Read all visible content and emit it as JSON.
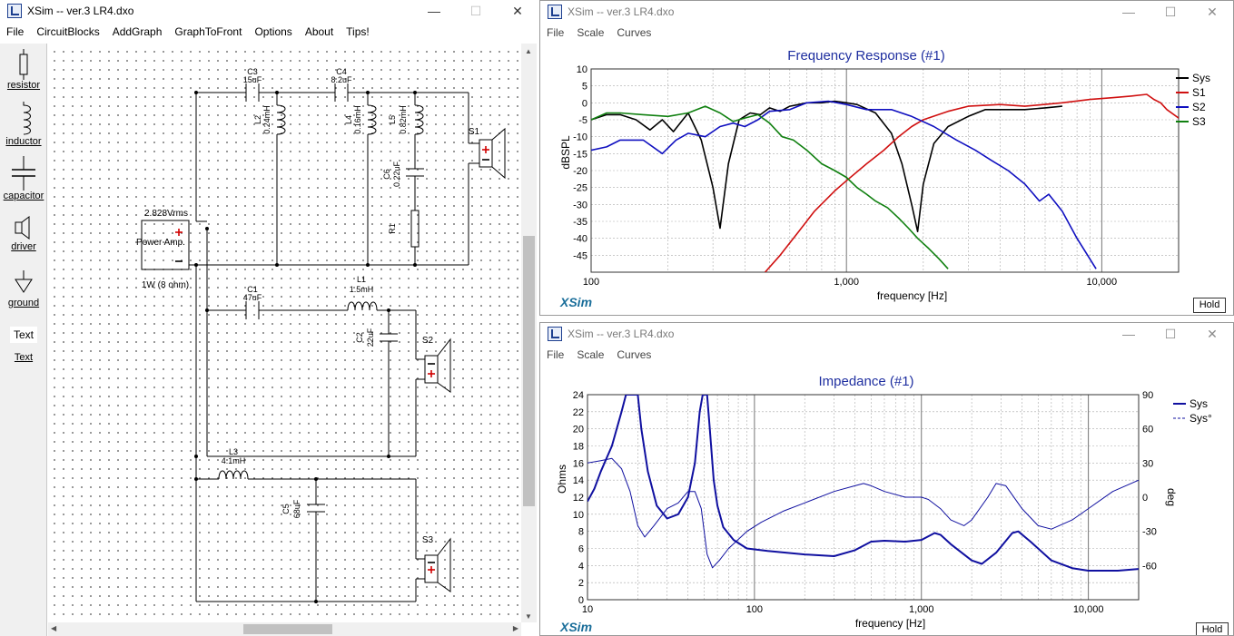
{
  "main_window": {
    "title": "XSim -- ver.3 LR4.dxo",
    "menu": [
      "File",
      "CircuitBlocks",
      "AddGraph",
      "GraphToFront",
      "Options",
      "About",
      "Tips!"
    ],
    "palette": [
      {
        "label": "resistor",
        "icon": "resistor-icon"
      },
      {
        "label": "inductor",
        "icon": "inductor-icon"
      },
      {
        "label": "capacitor",
        "icon": "capacitor-icon"
      },
      {
        "label": "driver",
        "icon": "driver-icon"
      },
      {
        "label": "ground",
        "icon": "ground-icon"
      },
      {
        "label": "Text",
        "icon": "text-icon",
        "preview": "Text"
      }
    ],
    "schematic": {
      "source_voltage": "2.828Vrms",
      "source_name": "Power Amp.",
      "source_note": "1W (8 ohm)",
      "components": {
        "C3_name": "C3",
        "C3_value": "15uF",
        "C4_name": "C4",
        "C4_value": "8.2uF",
        "L2_name": "L2",
        "L2_value": "0.24mH",
        "L4_name": "L4",
        "L4_value": "0.16mH",
        "L5_name": "L5",
        "L5_value": "0.82mH",
        "C6_name": "C6",
        "C6_value": "0.22uF",
        "R1_name": "R1",
        "C1_name": "C1",
        "C1_value": "47uF",
        "L1_name": "L1",
        "L1_value": "1.5mH",
        "C2_name": "C2",
        "C2_value": "22uF",
        "L3_name": "L3",
        "L3_value": "4.1mH",
        "C5_name": "C5",
        "C5_value": "68uF"
      },
      "drivers": [
        "S1",
        "S2",
        "S3"
      ]
    }
  },
  "freq_window": {
    "title": "XSim -- ver.3 LR4.dxo",
    "menu": [
      "File",
      "Scale",
      "Curves"
    ],
    "plot_title": "Frequency Response (#1)",
    "brand": "XSim",
    "hold_label": "Hold",
    "colors": {
      "Sys": "#000000",
      "S1": "#d01010",
      "S2": "#1010c0",
      "S3": "#108010",
      "title": "#1f2fa0"
    }
  },
  "imp_window": {
    "title": "XSim -- ver.3 LR4.dxo",
    "menu": [
      "File",
      "Scale",
      "Curves"
    ],
    "plot_title": "Impedance (#1)",
    "brand": "XSim",
    "hold_label": "Hold",
    "colors": {
      "Sys": "#1010a0",
      "title": "#1f2fa0"
    }
  },
  "chart_data": [
    {
      "type": "line",
      "title": "Frequency Response (#1)",
      "xlabel": "frequency [Hz]",
      "ylabel": "dBSPL",
      "xscale": "log",
      "xlim": [
        100,
        20000
      ],
      "ylim": [
        -50,
        10
      ],
      "xticks": [
        100,
        1000,
        10000
      ],
      "xtick_labels": [
        "100",
        "1,000",
        "10,000"
      ],
      "yticks": [
        10,
        5,
        0,
        -5,
        -10,
        -15,
        -20,
        -25,
        -30,
        -35,
        -40,
        -45
      ],
      "grid": true,
      "legend": "right",
      "series": [
        {
          "name": "Sys",
          "color": "#000000",
          "points": [
            [
              100,
              -5
            ],
            [
              115,
              -3.5
            ],
            [
              130,
              -3.5
            ],
            [
              150,
              -5
            ],
            [
              170,
              -8
            ],
            [
              190,
              -5
            ],
            [
              210,
              -8.5
            ],
            [
              240,
              -3
            ],
            [
              270,
              -11
            ],
            [
              300,
              -25
            ],
            [
              320,
              -37
            ],
            [
              345,
              -18
            ],
            [
              380,
              -5
            ],
            [
              420,
              -3
            ],
            [
              460,
              -3.5
            ],
            [
              500,
              -1.5
            ],
            [
              550,
              -2.5
            ],
            [
              600,
              -1
            ],
            [
              650,
              -0.5
            ],
            [
              700,
              0
            ],
            [
              800,
              0
            ],
            [
              900,
              0.5
            ],
            [
              1000,
              0
            ],
            [
              1100,
              -0.5
            ],
            [
              1300,
              -3
            ],
            [
              1500,
              -9
            ],
            [
              1650,
              -18
            ],
            [
              1800,
              -30
            ],
            [
              1900,
              -38
            ],
            [
              2000,
              -24
            ],
            [
              2200,
              -12
            ],
            [
              2500,
              -7
            ],
            [
              3000,
              -4
            ],
            [
              3500,
              -2
            ],
            [
              4000,
              -2
            ],
            [
              5000,
              -2
            ],
            [
              6000,
              -1.5
            ],
            [
              7000,
              -1
            ]
          ]
        },
        {
          "name": "S1",
          "color": "#d01010",
          "points": [
            [
              480,
              -50
            ],
            [
              550,
              -45
            ],
            [
              650,
              -38
            ],
            [
              750,
              -32
            ],
            [
              900,
              -26
            ],
            [
              1000,
              -23
            ],
            [
              1200,
              -18
            ],
            [
              1400,
              -14
            ],
            [
              1600,
              -10
            ],
            [
              1800,
              -7
            ],
            [
              2000,
              -5
            ],
            [
              2500,
              -2.5
            ],
            [
              3000,
              -1
            ],
            [
              4000,
              -0.5
            ],
            [
              5000,
              -1
            ],
            [
              7000,
              0
            ],
            [
              9000,
              1
            ],
            [
              11000,
              1.5
            ],
            [
              13000,
              2
            ],
            [
              15000,
              2.5
            ],
            [
              16000,
              1
            ],
            [
              17000,
              0
            ],
            [
              18000,
              -2
            ],
            [
              20000,
              -4.5
            ]
          ]
        },
        {
          "name": "S2",
          "color": "#1010c0",
          "points": [
            [
              100,
              -14
            ],
            [
              115,
              -13
            ],
            [
              130,
              -11
            ],
            [
              160,
              -11
            ],
            [
              190,
              -15
            ],
            [
              215,
              -11
            ],
            [
              240,
              -9
            ],
            [
              280,
              -10
            ],
            [
              320,
              -7
            ],
            [
              360,
              -6
            ],
            [
              400,
              -7
            ],
            [
              450,
              -5
            ],
            [
              500,
              -2.5
            ],
            [
              600,
              -2
            ],
            [
              700,
              0
            ],
            [
              850,
              0.5
            ],
            [
              1000,
              -0.5
            ],
            [
              1200,
              -2
            ],
            [
              1500,
              -2
            ],
            [
              1800,
              -4
            ],
            [
              2200,
              -7
            ],
            [
              2700,
              -11
            ],
            [
              3200,
              -14
            ],
            [
              3700,
              -17
            ],
            [
              4300,
              -20
            ],
            [
              5000,
              -24
            ],
            [
              5700,
              -29
            ],
            [
              6200,
              -27
            ],
            [
              7000,
              -32
            ],
            [
              8000,
              -40
            ],
            [
              9500,
              -49
            ]
          ]
        },
        {
          "name": "S3",
          "color": "#108010",
          "points": [
            [
              100,
              -5
            ],
            [
              115,
              -3
            ],
            [
              130,
              -3
            ],
            [
              160,
              -3.5
            ],
            [
              200,
              -4
            ],
            [
              240,
              -3
            ],
            [
              280,
              -1
            ],
            [
              320,
              -3
            ],
            [
              360,
              -5.5
            ],
            [
              400,
              -4.5
            ],
            [
              450,
              -3.5
            ],
            [
              500,
              -6
            ],
            [
              560,
              -10
            ],
            [
              620,
              -11
            ],
            [
              700,
              -14
            ],
            [
              800,
              -18
            ],
            [
              900,
              -20
            ],
            [
              1000,
              -22
            ],
            [
              1100,
              -25
            ],
            [
              1200,
              -27
            ],
            [
              1300,
              -29
            ],
            [
              1450,
              -31
            ],
            [
              1600,
              -34
            ],
            [
              1750,
              -37
            ],
            [
              1900,
              -40
            ],
            [
              2100,
              -43
            ],
            [
              2300,
              -46
            ],
            [
              2500,
              -49
            ]
          ]
        }
      ]
    },
    {
      "type": "line",
      "title": "Impedance (#1)",
      "xlabel": "frequency [Hz]",
      "ylabel": "Ohms",
      "y2label": "deg",
      "xscale": "log",
      "xlim": [
        10,
        20000
      ],
      "ylim": [
        0,
        24
      ],
      "y2lim": [
        -90,
        90
      ],
      "xticks": [
        10,
        100,
        1000,
        10000
      ],
      "xtick_labels": [
        "10",
        "100",
        "1,000",
        "10,000"
      ],
      "yticks": [
        24,
        22,
        20,
        18,
        16,
        14,
        12,
        10,
        8,
        6,
        4,
        2,
        0
      ],
      "y2ticks": [
        90,
        60,
        30,
        0,
        -30,
        -60
      ],
      "grid": true,
      "legend": "right",
      "series": [
        {
          "name": "Sys",
          "color": "#1010a0",
          "axis": "left",
          "points": [
            [
              10,
              11.5
            ],
            [
              11,
              13
            ],
            [
              12,
              15
            ],
            [
              14,
              18
            ],
            [
              16,
              22
            ],
            [
              17,
              24
            ],
            [
              20,
              24
            ],
            [
              21,
              20
            ],
            [
              23,
              15
            ],
            [
              26,
              11
            ],
            [
              30,
              9.5
            ],
            [
              35,
              10
            ],
            [
              40,
              12
            ],
            [
              44,
              16
            ],
            [
              47,
              22
            ],
            [
              49,
              24
            ],
            [
              52,
              24
            ],
            [
              54,
              20
            ],
            [
              57,
              14
            ],
            [
              60,
              11
            ],
            [
              65,
              8.5
            ],
            [
              75,
              7
            ],
            [
              90,
              6
            ],
            [
              120,
              5.7
            ],
            [
              200,
              5.3
            ],
            [
              300,
              5.1
            ],
            [
              400,
              5.8
            ],
            [
              500,
              6.8
            ],
            [
              600,
              6.9
            ],
            [
              800,
              6.8
            ],
            [
              1000,
              7
            ],
            [
              1200,
              7.8
            ],
            [
              1300,
              7.6
            ],
            [
              1500,
              6.5
            ],
            [
              2000,
              4.6
            ],
            [
              2300,
              4.2
            ],
            [
              2800,
              5.5
            ],
            [
              3500,
              7.8
            ],
            [
              3800,
              8
            ],
            [
              4500,
              6.8
            ],
            [
              6000,
              4.6
            ],
            [
              8000,
              3.7
            ],
            [
              10000,
              3.4
            ],
            [
              15000,
              3.4
            ],
            [
              20000,
              3.6
            ]
          ]
        },
        {
          "name": "Sys°",
          "color": "#1010a0",
          "axis": "right",
          "dashed_below": 60,
          "points": [
            [
              10,
              30
            ],
            [
              12,
              32
            ],
            [
              14,
              34
            ],
            [
              16,
              25
            ],
            [
              18,
              5
            ],
            [
              20,
              -25
            ],
            [
              22,
              -35
            ],
            [
              25,
              -25
            ],
            [
              30,
              -10
            ],
            [
              35,
              -5
            ],
            [
              40,
              5
            ],
            [
              44,
              5
            ],
            [
              48,
              -10
            ],
            [
              52,
              -50
            ],
            [
              56,
              -62
            ],
            [
              62,
              -55
            ],
            [
              70,
              -45
            ],
            [
              90,
              -30
            ],
            [
              110,
              -22
            ],
            [
              150,
              -12
            ],
            [
              200,
              -5
            ],
            [
              300,
              5
            ],
            [
              400,
              10
            ],
            [
              450,
              12
            ],
            [
              500,
              10
            ],
            [
              600,
              5
            ],
            [
              800,
              0
            ],
            [
              1000,
              0
            ],
            [
              1100,
              -2
            ],
            [
              1300,
              -10
            ],
            [
              1500,
              -20
            ],
            [
              1800,
              -25
            ],
            [
              2000,
              -20
            ],
            [
              2500,
              0
            ],
            [
              2800,
              12
            ],
            [
              3200,
              10
            ],
            [
              4000,
              -10
            ],
            [
              5000,
              -25
            ],
            [
              6000,
              -28
            ],
            [
              8000,
              -20
            ],
            [
              10000,
              -10
            ],
            [
              14000,
              5
            ],
            [
              20000,
              15
            ]
          ]
        }
      ]
    }
  ]
}
